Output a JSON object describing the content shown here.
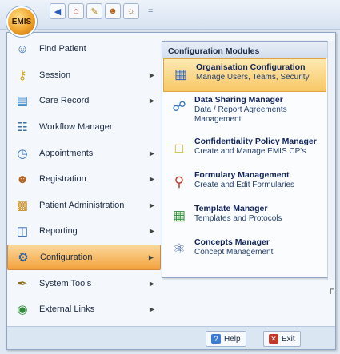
{
  "app": {
    "orb_label": "EMIS"
  },
  "quick_access": {
    "buttons": [
      {
        "icon": "back-icon"
      },
      {
        "icon": "home-icon"
      },
      {
        "icon": "pencil-icon"
      },
      {
        "icon": "user-icon"
      },
      {
        "icon": "users-icon"
      }
    ],
    "more_glyph": "="
  },
  "left_menu": {
    "items": [
      {
        "label": "Find Patient",
        "icon": "find-patient-icon",
        "has_submenu": false
      },
      {
        "label": "Session",
        "icon": "key-icon",
        "has_submenu": true
      },
      {
        "label": "Care Record",
        "icon": "care-record-icon",
        "has_submenu": true
      },
      {
        "label": "Workflow Manager",
        "icon": "clipboard-icon",
        "has_submenu": false
      },
      {
        "label": "Appointments",
        "icon": "calendar-icon",
        "has_submenu": true
      },
      {
        "label": "Registration",
        "icon": "registration-icon",
        "has_submenu": true
      },
      {
        "label": "Patient Administration",
        "icon": "folder-icon",
        "has_submenu": true
      },
      {
        "label": "Reporting",
        "icon": "report-icon",
        "has_submenu": true
      },
      {
        "label": "Configuration",
        "icon": "configuration-icon",
        "has_submenu": true,
        "active": true
      },
      {
        "label": "System Tools",
        "icon": "pen-tool-icon",
        "has_submenu": true
      },
      {
        "label": "External Links",
        "icon": "globe-icon",
        "has_submenu": true
      }
    ]
  },
  "submenu": {
    "header": "Configuration Modules",
    "modules": [
      {
        "title": "Organisation Configuration",
        "desc": "Manage Users, Teams, Security",
        "icon": "organisation-icon",
        "active": true
      },
      {
        "title": "Data Sharing Manager",
        "desc": "Data / Report Agreements Management",
        "icon": "sharing-icon"
      },
      {
        "title": "Confidentiality Policy Manager",
        "desc": "Create and Manage EMIS CP's",
        "icon": "lock-icon"
      },
      {
        "title": "Formulary Management",
        "desc": "Create and Edit Formularies",
        "icon": "formulary-icon"
      },
      {
        "title": "Template Manager",
        "desc": "Templates and Protocols",
        "icon": "grid-icon"
      },
      {
        "title": "Concepts Manager",
        "desc": "Concept Management",
        "icon": "atom-icon"
      }
    ]
  },
  "footer": {
    "help_label": "Help",
    "exit_label": "Exit"
  },
  "background": {
    "right_edge_glyph": "F"
  }
}
